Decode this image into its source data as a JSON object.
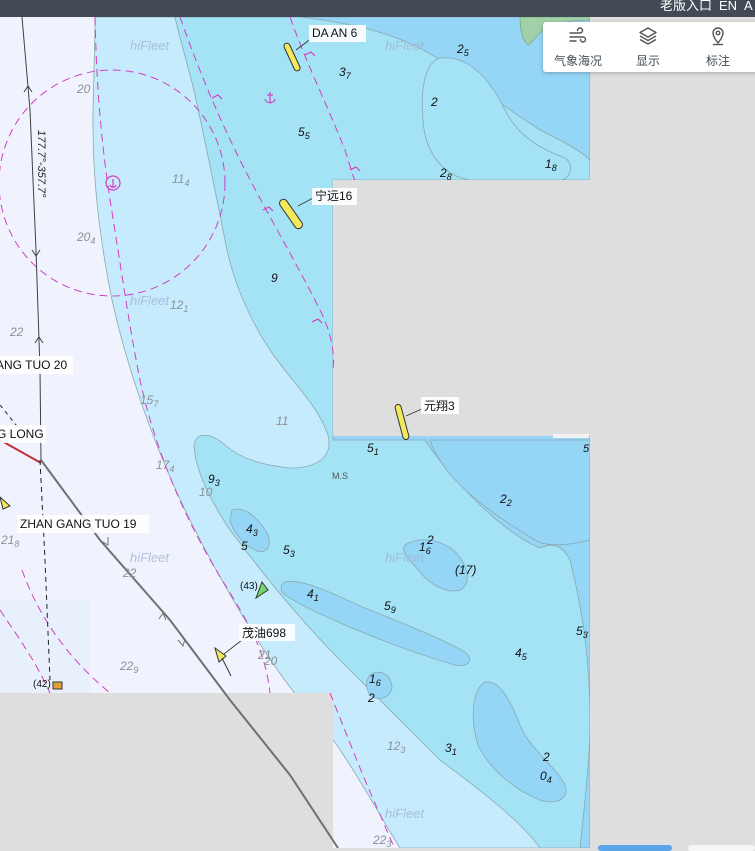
{
  "topbar": {
    "items": [
      "老版入口",
      "EN",
      "A"
    ]
  },
  "toolbar": {
    "weather_label": "气象海况",
    "display_label": "显示",
    "annotate_label": "标注"
  },
  "vessels": {
    "da_an_6": "DA AN 6",
    "ning_yuan_16": "宁远16",
    "yuan_xiang_3": "元翔3",
    "mao_you_698": "茂油698",
    "zhan_gang_tuo_19": "ZHAN GANG TUO 19",
    "ang_tuo_20": "ANG TUO 20",
    "g_long": "G LONG",
    "count_43": "(43)",
    "count_42": "(42)"
  },
  "chart": {
    "watermark": "hiFleet",
    "course_label": "177.7°-357.7°",
    "seabed_note": "M.S",
    "colors": {
      "deep_water": "#f0f3fd",
      "mid_water": "#c6ebfc",
      "shallow_water": "#a4e2f6",
      "shoal": "#95d5f6",
      "land": "#a2d1a8",
      "track_magenta": "#d23fc1",
      "route_gray": "#707070",
      "vessel_yellow": "#f2ea5c",
      "tanker_green": "#77d66a",
      "no_data": "#dedede"
    }
  },
  "soundings": [
    {
      "main": "2",
      "sub": "5"
    },
    {
      "main": "3",
      "sub": "7"
    },
    {
      "main": "2",
      "sub": ""
    },
    {
      "main": "5",
      "sub": "5"
    },
    {
      "main": "1",
      "sub": "8"
    },
    {
      "main": "2",
      "sub": "8"
    },
    {
      "main": "20",
      "sub": ""
    },
    {
      "main": "11",
      "sub": "4"
    },
    {
      "main": "20",
      "sub": "4"
    },
    {
      "main": "9",
      "sub": ""
    },
    {
      "main": "12",
      "sub": "1"
    },
    {
      "main": "22",
      "sub": ""
    },
    {
      "main": "15",
      "sub": "7"
    },
    {
      "main": "11",
      "sub": ""
    },
    {
      "main": "5",
      "sub": "1"
    },
    {
      "main": "17",
      "sub": "4"
    },
    {
      "main": "9",
      "sub": "3"
    },
    {
      "main": "10",
      "sub": ""
    },
    {
      "main": "2",
      "sub": "2"
    },
    {
      "main": "4",
      "sub": "3"
    },
    {
      "main": "5",
      "sub": ""
    },
    {
      "main": "5",
      "sub": "3"
    },
    {
      "main": "21",
      "sub": "8"
    },
    {
      "main": "1",
      "sub": "6"
    },
    {
      "main": "2",
      "sub": ""
    },
    {
      "main": "(17)",
      "sub": ""
    },
    {
      "main": "22",
      "sub": ""
    },
    {
      "main": "4",
      "sub": "1"
    },
    {
      "main": "5",
      "sub": "9"
    },
    {
      "main": "5",
      "sub": "3"
    },
    {
      "main": "22",
      "sub": "9"
    },
    {
      "main": "21",
      "sub": ""
    },
    {
      "main": "20",
      "sub": ""
    },
    {
      "main": "4",
      "sub": "5"
    },
    {
      "main": "1",
      "sub": "6"
    },
    {
      "main": "2",
      "sub": ""
    },
    {
      "main": "12",
      "sub": "3"
    },
    {
      "main": "3",
      "sub": "1"
    },
    {
      "main": "2",
      "sub": ""
    },
    {
      "main": "0",
      "sub": "4"
    },
    {
      "main": "22",
      "sub": "3"
    }
  ]
}
